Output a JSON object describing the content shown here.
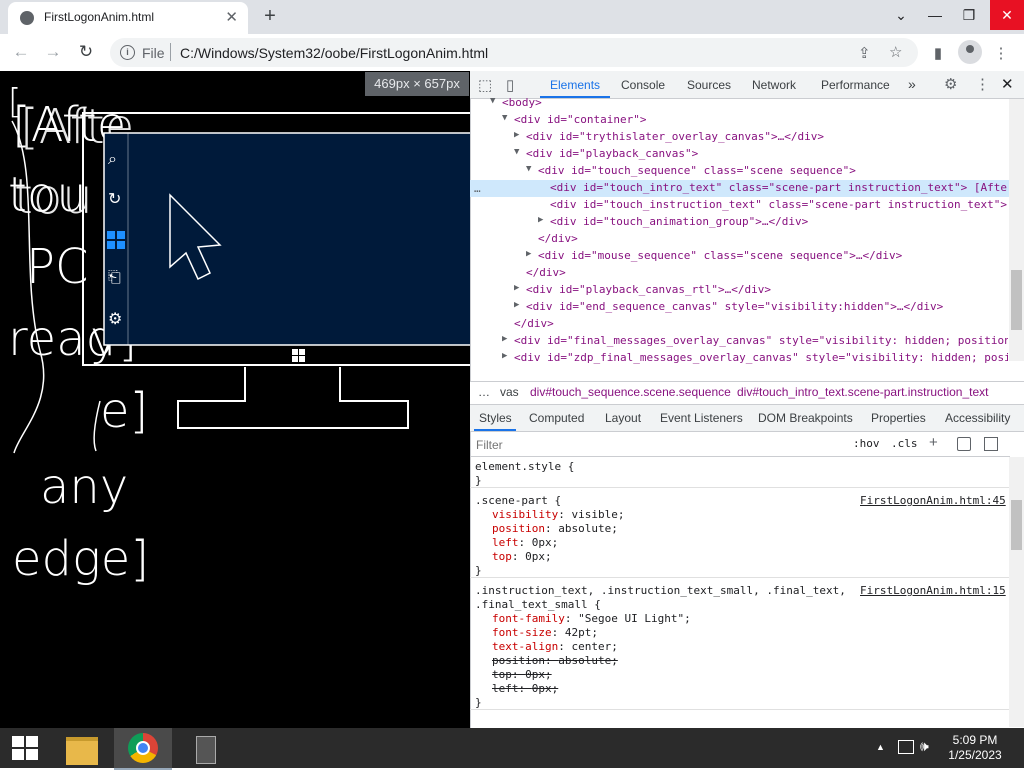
{
  "browser": {
    "tab_title": "FirstLogonAnim.html",
    "tab_close": "✕",
    "new_tab": "+",
    "window_minimize": "⌄",
    "window_min2": "—",
    "window_restore": "❐",
    "window_close": "✕",
    "back": "←",
    "forward": "→",
    "reload": "↻",
    "info": "i",
    "scheme_label": "File",
    "url": "C:/Windows/System32/oobe/FirstLogonAnim.html",
    "share_icon": "⇪",
    "bookmark_icon": "☆",
    "sidepanel_icon": "▮",
    "menu_icon": "⋮"
  },
  "page": {
    "dimensions_badge": "469px × 657px",
    "left_bracket": "[",
    "text_lines": [
      "[Afte",
      "tou",
      "PC",
      "read",
      "y]",
      "e]",
      "any",
      "edge]"
    ]
  },
  "devtools": {
    "tabs": [
      "Elements",
      "Console",
      "Sources",
      "Network",
      "Performance"
    ],
    "more_tabs": "»",
    "settings_icon": "⚙",
    "more_icon": "⋮",
    "close_icon": "✕",
    "inspect_icon": "⬚",
    "device_icon": "▯",
    "dom_lines": [
      {
        "indent": 2,
        "arrow": "▼",
        "html": "<body>"
      },
      {
        "indent": 3,
        "arrow": "▼",
        "html": "<div id=\"container\">"
      },
      {
        "indent": 4,
        "arrow": "▶",
        "html": "<div id=\"trythislater_overlay_canvas\">…</div>"
      },
      {
        "indent": 4,
        "arrow": "▼",
        "html": "<div id=\"playback_canvas\">"
      },
      {
        "indent": 5,
        "arrow": "▼",
        "html": "<div id=\"touch_sequence\" class=\"scene sequence\">"
      },
      {
        "indent": 6,
        "arrow": "",
        "html": "<div id=\"touch_intro_text\" class=\"scene-part instruction_text\"> [After"
      },
      {
        "indent": 6,
        "arrow": "",
        "html": "<div id=\"touch_instruction_text\" class=\"scene-part instruction_text\">"
      },
      {
        "indent": 6,
        "arrow": "▶",
        "html": "<div id=\"touch_animation_group\">…</div>"
      },
      {
        "indent": 5,
        "arrow": "",
        "html": "</div>"
      },
      {
        "indent": 5,
        "arrow": "▶",
        "html": "<div id=\"mouse_sequence\" class=\"scene sequence\">…</div>"
      },
      {
        "indent": 4,
        "arrow": "",
        "html": "</div>"
      },
      {
        "indent": 4,
        "arrow": "▶",
        "html": "<div id=\"playback_canvas_rtl\">…</div>"
      },
      {
        "indent": 4,
        "arrow": "▶",
        "html": "<div id=\"end_sequence_canvas\" style=\"visibility:hidden\">…</div>"
      },
      {
        "indent": 3,
        "arrow": "",
        "html": "</div>"
      },
      {
        "indent": 3,
        "arrow": "▶",
        "html": "<div id=\"final_messages_overlay_canvas\" style=\"visibility: hidden; position:"
      },
      {
        "indent": 3,
        "arrow": "▶",
        "html": "<div id=\"zdp_final_messages_overlay_canvas\" style=\"visibility: hidden; posit"
      }
    ],
    "dom_ellipsis": "…",
    "breadcrumbs": [
      "…",
      "vas",
      "div#touch_sequence.scene.sequence",
      "div#touch_intro_text.scene-part.instruction_text"
    ],
    "styles_tabs": [
      "Styles",
      "Computed",
      "Layout",
      "Event Listeners",
      "DOM Breakpoints",
      "Properties",
      "Accessibility"
    ],
    "filter_placeholder": "Filter",
    "hov": ":hov",
    "cls": ".cls",
    "plus": "+",
    "rules": [
      {
        "selector": "element.style {",
        "source": "",
        "props": [],
        "close": "}"
      },
      {
        "selector": ".scene-part {",
        "source": "FirstLogonAnim.html:45",
        "props": [
          {
            "name": "visibility",
            "value": "visible;",
            "struck": false
          },
          {
            "name": "position",
            "value": "absolute;",
            "struck": false
          },
          {
            "name": "left",
            "value": "0px;",
            "struck": false
          },
          {
            "name": "top",
            "value": "0px;",
            "struck": false
          }
        ],
        "close": "}"
      },
      {
        "selector": ".instruction_text, .instruction_text_small, .final_text,",
        "selector2": ".final_text_small {",
        "source": "FirstLogonAnim.html:15",
        "props": [
          {
            "name": "font-family",
            "value": "\"Segoe UI Light\";",
            "struck": false
          },
          {
            "name": "font-size",
            "value": "42pt;",
            "struck": false
          },
          {
            "name": "text-align",
            "value": "center;",
            "struck": false
          },
          {
            "name": "position",
            "value": "absolute;",
            "struck": true
          },
          {
            "name": "top",
            "value": "0px;",
            "struck": true
          },
          {
            "name": "left",
            "value": "0px;",
            "struck": true
          }
        ],
        "close": "}"
      }
    ]
  },
  "taskbar": {
    "time": "5:09 PM",
    "date": "1/25/2023",
    "tray_up": "▲"
  },
  "colors": {
    "accent": "#1a73e8",
    "page_bg": "#000000",
    "screen_bg": "#001a3a",
    "taskbar": "#2b2b2b"
  }
}
